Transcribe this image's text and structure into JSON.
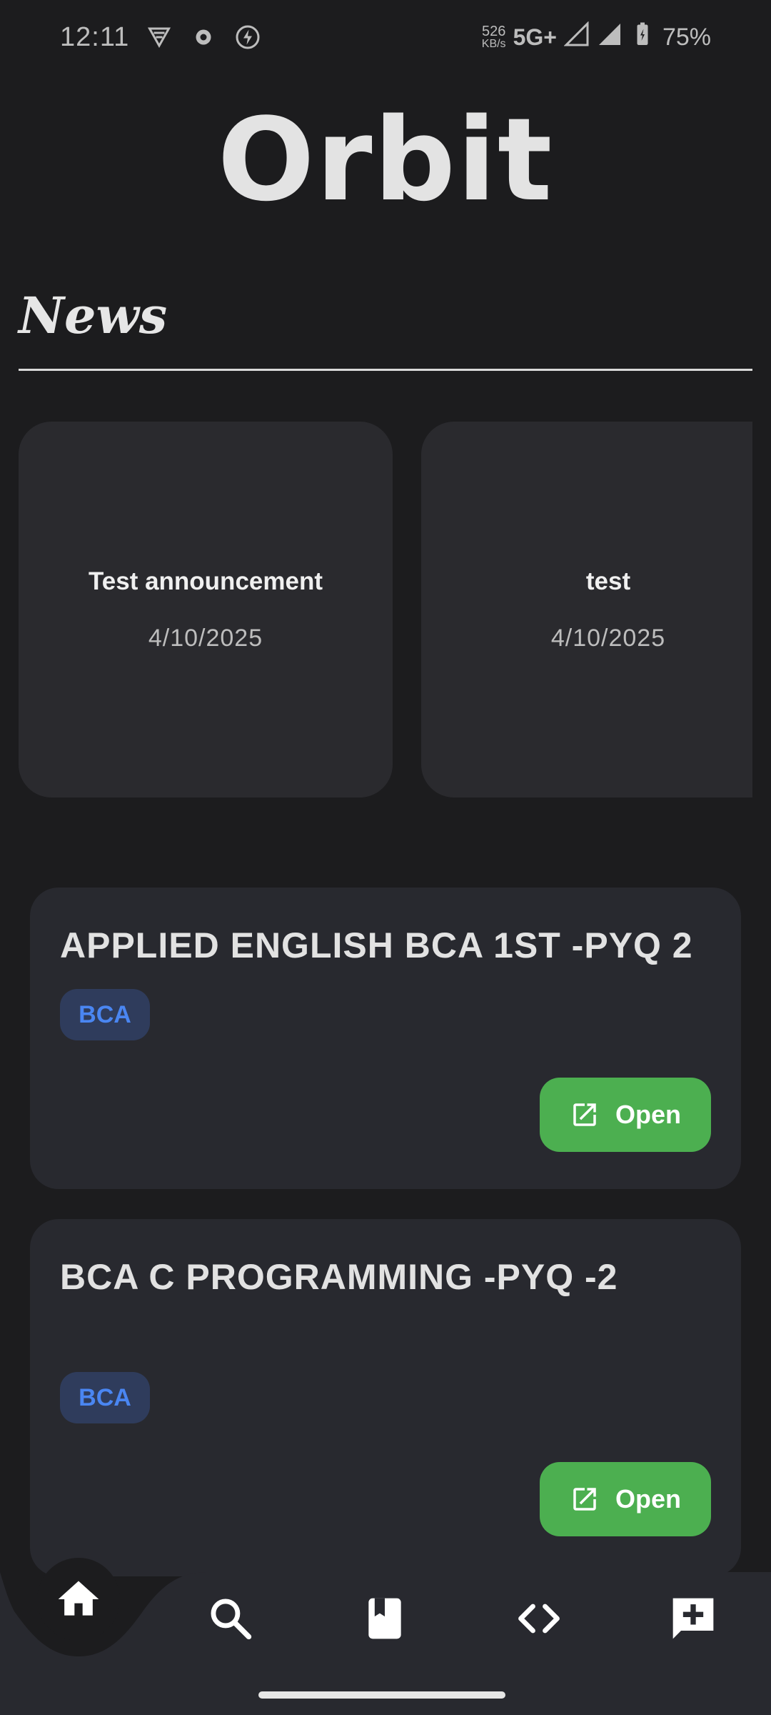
{
  "status_bar": {
    "time": "12:11",
    "net_speed_value": "526",
    "net_speed_unit": "KB/s",
    "network_type": "5G+",
    "battery": "75%",
    "icons": [
      "vpn-icon",
      "settings-gear-icon",
      "charging-bolt-icon",
      "signal-icon",
      "signal-icon",
      "battery-icon"
    ]
  },
  "app": {
    "title": "Orbit"
  },
  "news": {
    "heading": "News",
    "items": [
      {
        "title": "Test announcement",
        "date": "4/10/2025"
      },
      {
        "title": "test",
        "date": "4/10/2025"
      }
    ]
  },
  "resources": [
    {
      "title": "APPLIED ENGLISH BCA 1ST -PYQ 2",
      "tag": "BCA",
      "action": "Open"
    },
    {
      "title": "BCA C PROGRAMMING -PYQ -2",
      "tag": "BCA",
      "action": "Open"
    }
  ],
  "bottom_nav": {
    "items": [
      "home-icon",
      "search-icon",
      "bookmark-icon",
      "code-icon",
      "add-comment-icon"
    ],
    "active": "home-icon"
  },
  "colors": {
    "background": "#1c1c1e",
    "card": "#28292f",
    "accent_green": "#4caf50",
    "tag_text": "#4a86f2",
    "tag_bg": "#2f3c5c"
  }
}
